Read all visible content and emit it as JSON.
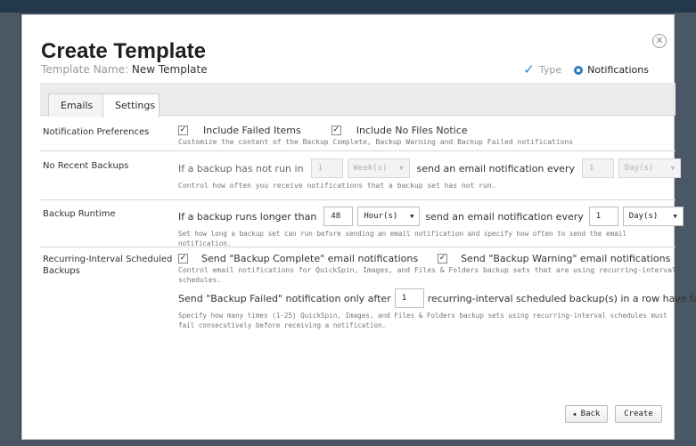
{
  "modal": {
    "title": "Create Template",
    "template_name_label": "Template Name:",
    "template_name_value": "New Template",
    "close_glyph": "✕"
  },
  "steps": [
    {
      "label": "Type",
      "state": "done",
      "icon": "check-icon"
    },
    {
      "label": "Notifications",
      "state": "active",
      "icon": "step-dot-icon"
    }
  ],
  "tabs": [
    {
      "label": "Emails",
      "selected": false
    },
    {
      "label": "Settings",
      "selected": true
    }
  ],
  "notification_preferences": {
    "label": "Notification Preferences",
    "include_failed_items": {
      "label": "Include Failed Items",
      "checked": true
    },
    "include_no_files": {
      "label": "Include No Files Notice",
      "checked": true
    },
    "help": "Customize the content of the Backup Complete, Backup Warning and Backup Failed notifications"
  },
  "no_recent_backups": {
    "label": "No Recent Backups",
    "text_before": "If a backup has not run in",
    "value": "1",
    "unit": "Week(s)",
    "text_middle": "send an email notification every",
    "every_value": "1",
    "every_unit": "Day(s)",
    "help": "Control how often you receive notifications that a backup set has not run.",
    "disabled": true
  },
  "backup_runtime": {
    "label": "Backup Runtime",
    "text_before": "If a backup runs longer than",
    "value": "48",
    "unit": "Hour(s)",
    "text_middle": "send an email notification every",
    "every_value": "1",
    "every_unit": "Day(s)",
    "help": "Set how long a backup set can run before sending an email notification and specify how often to send the email notification."
  },
  "recurring_interval": {
    "label_line1": "Recurring-Interval Scheduled",
    "label_line2": "Backups",
    "send_complete": {
      "label": "Send \"Backup Complete\" email notifications",
      "checked": true
    },
    "send_warning": {
      "label": "Send \"Backup Warning\" email notifications",
      "checked": true
    },
    "help1_line1": "Control email notifications for QuickSpin, Images, and Files & Folders backup sets that are using recurring-interval",
    "help1_line2": "schedules.",
    "failed_text_before": "Send \"Backup Failed\" notification only after",
    "failed_value": "1",
    "failed_text_after": "recurring-interval scheduled backup(s) in a row have failed.",
    "help2_line1": "Specify how many times (1-25) QuickSpin, Images, and Files & Folders backup sets using recurring-interval schedules must",
    "help2_line2": "fail consecutively before receiving a notification."
  },
  "footer": {
    "back_label": "Back",
    "create_label": "Create"
  },
  "colors": {
    "accent": "#2d7fc4"
  }
}
